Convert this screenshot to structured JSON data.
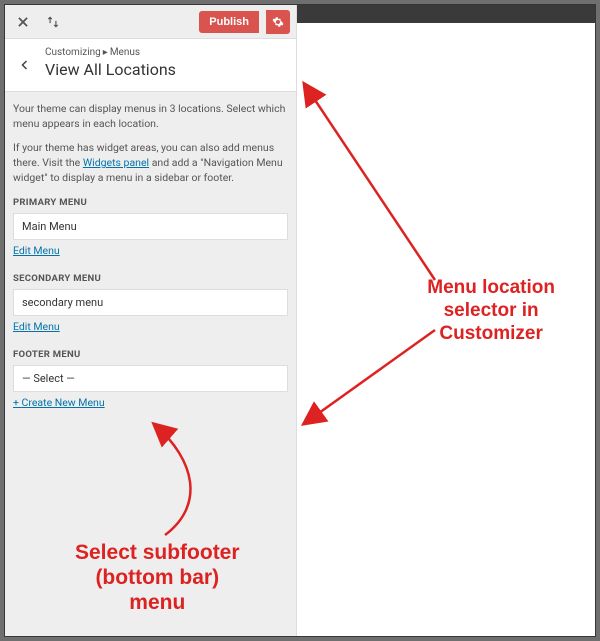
{
  "topbar": {
    "publish_label": "Publish"
  },
  "header": {
    "crumb_root": "Customizing",
    "crumb_section": "Menus",
    "title": "View All Locations"
  },
  "intro": {
    "p1": "Your theme can display menus in 3 locations. Select which menu appears in each location.",
    "p2_a": "If your theme has widget areas, you can also add menus there. Visit the ",
    "p2_link": "Widgets panel",
    "p2_b": " and add a \"Navigation Menu widget\" to display a menu in a sidebar or footer."
  },
  "sections": {
    "primary": {
      "label": "PRIMARY MENU",
      "value": "Main Menu",
      "edit": "Edit Menu"
    },
    "secondary": {
      "label": "SECONDARY MENU",
      "value": "secondary menu",
      "edit": "Edit Menu"
    },
    "footer": {
      "label": "FOOTER MENU",
      "value": "— Select —",
      "create": "+ Create New Menu"
    }
  },
  "annotations": {
    "a1_l1": "Menu location",
    "a1_l2": "selector in",
    "a1_l3": "Customizer",
    "a2_l1": "Select subfooter",
    "a2_l2": "(bottom bar)",
    "a2_l3": "menu"
  }
}
